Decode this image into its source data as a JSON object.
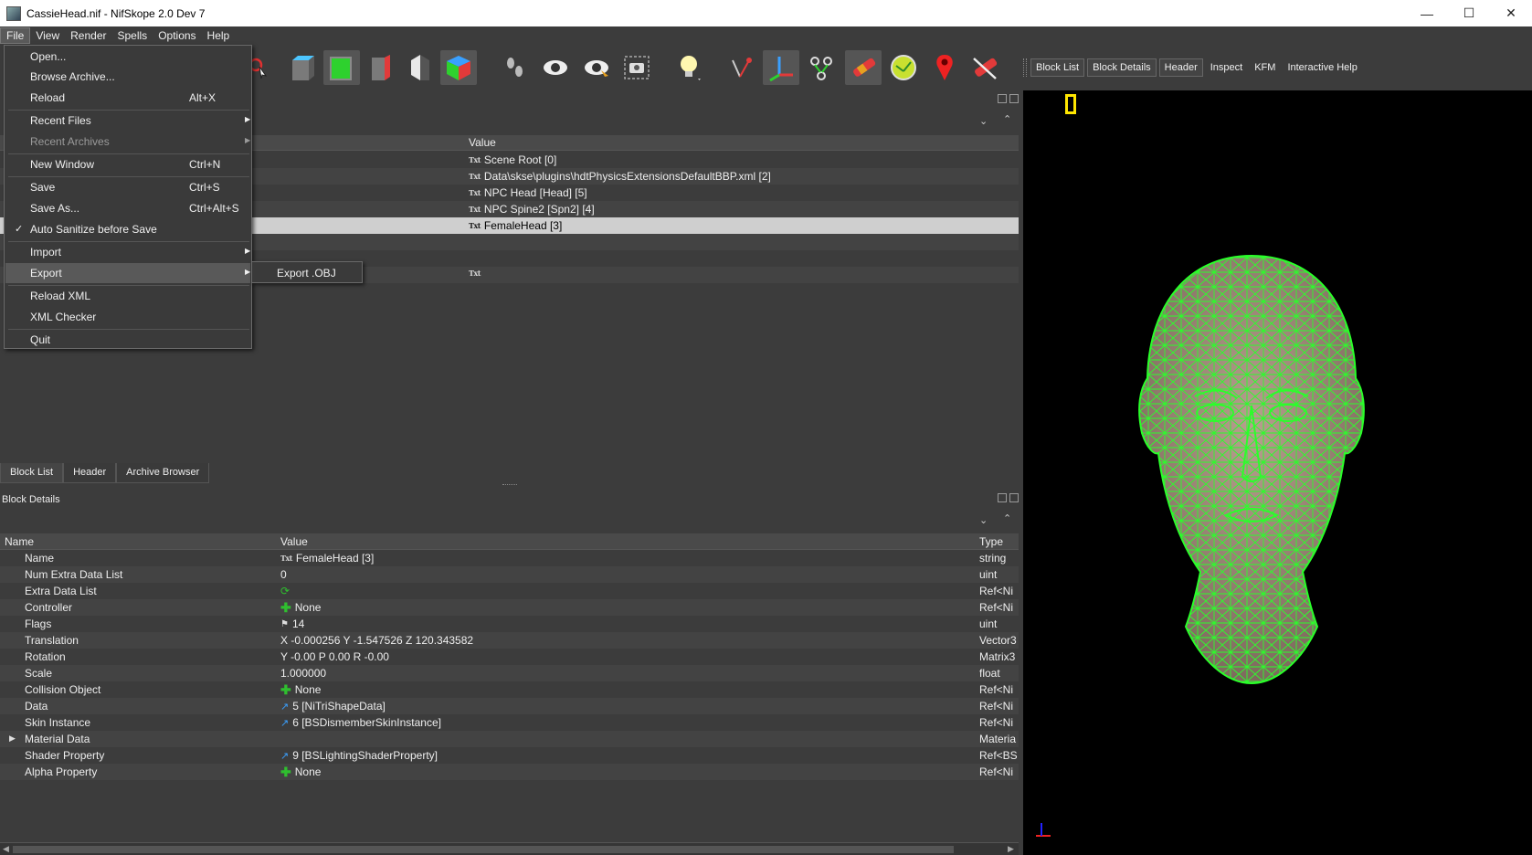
{
  "window": {
    "title": "CassieHead.nif - NifSkope 2.0 Dev 7",
    "minimize": "—",
    "maximize": "☐",
    "close": "✕"
  },
  "menubar": [
    "File",
    "View",
    "Render",
    "Spells",
    "Options",
    "Help"
  ],
  "toolbar_tabs": [
    "Block List",
    "Block Details",
    "Header",
    "Inspect",
    "KFM",
    "Interactive Help"
  ],
  "file_menu": {
    "items": {
      "open": "Open...",
      "browse_archive": "Browse Archive...",
      "reload": "Reload",
      "reload_shortcut": "Alt+X",
      "recent_files": "Recent Files",
      "recent_archives": "Recent Archives",
      "new_window": "New Window",
      "new_window_shortcut": "Ctrl+N",
      "save": "Save",
      "save_shortcut": "Ctrl+S",
      "save_as": "Save As...",
      "save_as_shortcut": "Ctrl+Alt+S",
      "auto_sanitize": "Auto Sanitize before Save",
      "import": "Import",
      "export": "Export",
      "reload_xml": "Reload XML",
      "xml_checker": "XML Checker",
      "quit": "Quit"
    },
    "export_submenu": "Export .OBJ"
  },
  "block_list": {
    "value_header": "Value",
    "rows": [
      "Scene Root [0]",
      "Data\\skse\\plugins\\hdtPhysicsExtensionsDefaultBBP.xml [2]",
      "NPC Head [Head] [5]",
      "NPC Spine2 [Spn2] [4]",
      "FemaleHead [3]"
    ]
  },
  "bottom_tabs": [
    "Block List",
    "Header",
    "Archive Browser"
  ],
  "block_details": {
    "title": "Block Details",
    "headers": {
      "name": "Name",
      "value": "Value",
      "type": "Type"
    },
    "rows": [
      {
        "name": "Name",
        "value": "FemaleHead [3]",
        "type": "string"
      },
      {
        "name": "Num Extra Data List",
        "value": "0",
        "type": "uint"
      },
      {
        "name": "Extra Data List",
        "value": "",
        "type": "Ref<Ni"
      },
      {
        "name": "Controller",
        "value": "None",
        "type": "Ref<Ni"
      },
      {
        "name": "Flags",
        "value": "14",
        "type": "uint"
      },
      {
        "name": "Translation",
        "value": "X -0.000256 Y -1.547526 Z 120.343582",
        "type": "Vector3"
      },
      {
        "name": "Rotation",
        "value": "Y -0.00 P 0.00 R -0.00",
        "type": "Matrix3"
      },
      {
        "name": "Scale",
        "value": "1.000000",
        "type": "float"
      },
      {
        "name": "Collision Object",
        "value": "None",
        "type": "Ref<Ni"
      },
      {
        "name": "Data",
        "value": "5 [NiTriShapeData]",
        "type": "Ref<Ni"
      },
      {
        "name": "Skin Instance",
        "value": "6 [BSDismemberSkinInstance]",
        "type": "Ref<Ni"
      },
      {
        "name": "Material Data",
        "value": "",
        "type": "Materia"
      },
      {
        "name": "Shader Property",
        "value": "9 [BSLightingShaderProperty]",
        "type": "Ref<BS"
      },
      {
        "name": "Alpha Property",
        "value": "None",
        "type": "Ref<Ni"
      }
    ]
  },
  "colors": {
    "accent_wireframe": "#2aff2a",
    "viewport_bg": "#000000",
    "selection": "#cfcfcf"
  }
}
